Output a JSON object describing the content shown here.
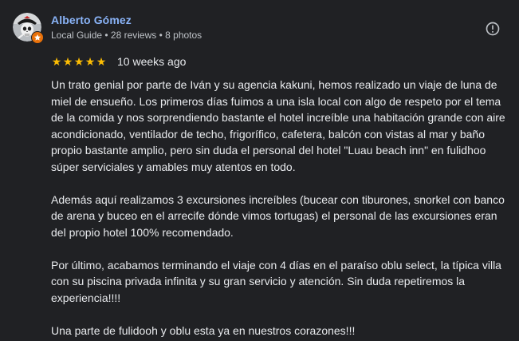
{
  "author": {
    "name": "Alberto Gómez",
    "meta": "Local Guide • 28 reviews • 8 photos",
    "avatar_icon": "pirate-skull-avatar-icon",
    "badge_icon": "local-guide-star-icon"
  },
  "actions": {
    "report_icon": "report-flag-icon"
  },
  "rating": {
    "stars": 5,
    "max_stars": 5,
    "star_color": "#fbbc04",
    "date": "10 weeks ago"
  },
  "review": {
    "paragraphs": [
      "Un trato genial por parte de Iván y su agencia kakuni, hemos realizado un viaje de luna de miel de ensueño. Los primeros días fuimos a una isla local con algo de respeto por el tema de la comida y nos sorprendiendo bastante el hotel increíble una habitación grande con aire acondicionado, ventilador de techo, frigorífico, cafetera, balcón con vistas al mar y baño propio bastante amplio, pero sin duda el personal del hotel \"Luau beach inn\" en fulidhoo súper serviciales y amables muy atentos en todo.",
      "Además aquí realizamos 3 excursiones increíbles (bucear con tiburones, snorkel con banco de arena y buceo en el arrecife dónde vimos tortugas) el personal de las excursiones eran del propio hotel 100% recomendado.",
      "Por último, acabamos terminando el viaje con 4 días en el paraíso oblu select, la típica villa con su piscina privada infinita y su gran servicio y atención. Sin duda repetiremos la experiencia!!!!",
      "Una parte de fulidooh y oblu esta ya en nuestros corazones!!!"
    ]
  },
  "colors": {
    "background": "#202124",
    "author_link": "#8ab4f8",
    "text": "#e8eaed",
    "meta_text": "#bdc1c6",
    "badge": "#e8710a"
  }
}
